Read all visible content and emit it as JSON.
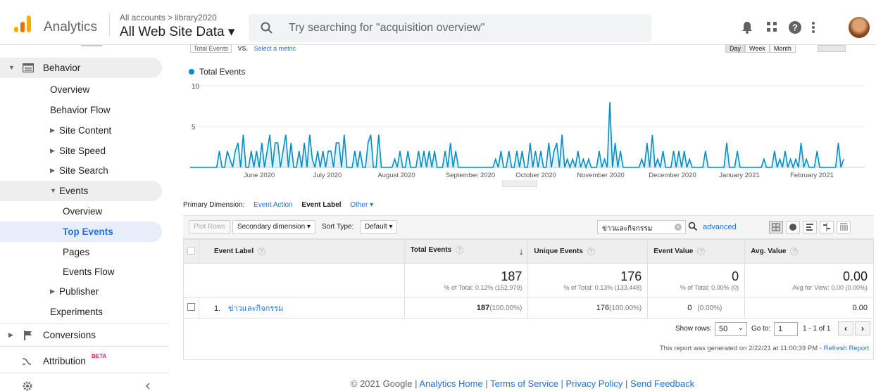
{
  "header": {
    "app_name": "Analytics",
    "breadcrumb": "All accounts > library2020",
    "property": "All Web Site Data ▾",
    "search_placeholder": "Try searching for \"acquisition overview\""
  },
  "sidebar": {
    "behavior": "Behavior",
    "overview": "Overview",
    "behavior_flow": "Behavior Flow",
    "site_content": "Site Content",
    "site_speed": "Site Speed",
    "site_search": "Site Search",
    "events": "Events",
    "events_overview": "Overview",
    "top_events": "Top Events",
    "pages": "Pages",
    "events_flow": "Events Flow",
    "publisher": "Publisher",
    "experiments": "Experiments",
    "conversions": "Conversions",
    "attribution": "Attribution",
    "beta": "BETA"
  },
  "chart_top": {
    "metric_select": "Total Events",
    "vs": "VS.",
    "select_metric": "Select a metric",
    "day": "Day",
    "week": "Week",
    "month": "Month"
  },
  "chart_data": {
    "type": "line",
    "title": "",
    "legend": "Total Events",
    "y_ticks": [
      "10",
      "5"
    ],
    "ylim": [
      0,
      10
    ],
    "x_tick_labels": [
      "June 2020",
      "July 2020",
      "August 2020",
      "September 2020",
      "October 2020",
      "November 2020",
      "December 2020",
      "January 2021",
      "February 2021"
    ],
    "series": [
      {
        "name": "Total Events",
        "values": [
          0,
          0,
          0,
          0,
          0,
          0,
          0,
          0,
          0,
          0,
          0,
          2,
          0,
          0,
          2,
          1,
          0,
          2,
          3,
          0,
          4,
          0,
          0,
          2,
          0,
          2,
          0,
          3,
          0,
          2,
          4,
          0,
          3,
          3,
          0,
          2,
          4,
          0,
          3,
          0,
          0,
          2,
          0,
          3,
          0,
          4,
          1,
          0,
          2,
          0,
          2,
          0,
          2,
          2,
          0,
          3,
          3,
          0,
          4,
          0,
          0,
          0,
          2,
          0,
          2,
          0,
          0,
          3,
          4,
          0,
          0,
          4,
          0,
          0,
          0,
          0,
          0,
          1,
          0,
          2,
          0,
          0,
          2,
          0,
          0,
          0,
          2,
          0,
          2,
          0,
          2,
          0,
          2,
          0,
          0,
          0,
          2,
          0,
          3,
          0,
          2,
          0,
          0,
          0,
          0,
          0,
          0,
          0,
          0,
          0,
          0,
          0,
          0,
          0,
          0,
          1,
          0,
          2,
          0,
          0,
          2,
          0,
          0,
          2,
          0,
          2,
          0,
          0,
          3,
          0,
          2,
          0,
          2,
          0,
          0,
          3,
          0,
          2,
          3,
          0,
          4,
          0,
          1,
          0,
          1,
          0,
          2,
          0,
          1,
          0,
          1,
          0,
          0,
          0,
          2,
          0,
          1,
          0,
          8,
          0,
          3,
          0,
          2,
          0,
          0,
          0,
          0,
          0,
          0,
          0,
          1,
          0,
          3,
          0,
          4,
          0,
          1,
          0,
          2,
          0,
          0,
          0,
          2,
          0,
          2,
          0,
          2,
          0,
          1,
          0,
          0,
          0,
          0,
          0,
          2,
          0,
          0,
          0,
          0,
          0,
          0,
          0,
          3,
          0,
          0,
          0,
          2,
          0,
          0,
          0,
          0,
          0,
          0,
          0,
          0,
          0,
          1,
          0,
          0,
          0,
          2,
          0,
          1,
          0,
          2,
          0,
          1,
          0,
          1,
          0,
          3,
          0,
          1,
          0,
          0,
          0,
          2,
          0,
          0,
          0,
          0,
          0,
          0,
          0,
          3,
          0,
          1
        ]
      }
    ]
  },
  "report": {
    "primary_dimension_label": "Primary Dimension:",
    "dim_event_action": "Event Action",
    "dim_event_label": "Event Label",
    "dim_other": "Other ▾",
    "plot_rows": "Plot Rows",
    "secondary_dimension": "Secondary dimension ▾",
    "sort_type_label": "Sort Type:",
    "sort_type_value": "Default ▾",
    "filter_value": "ข่าวและกิจกรรม",
    "advanced": "advanced",
    "columns": [
      "Event Label",
      "Total Events",
      "Unique Events",
      "Event Value",
      "Avg. Value"
    ],
    "totals": {
      "total_events": "187",
      "total_events_pct": "% of Total: 0.12% (152,979)",
      "unique_events": "176",
      "unique_events_pct": "% of Total: 0.13% (133,448)",
      "event_value": "0",
      "event_value_pct": "% of Total: 0.00% (0)",
      "avg_value": "0.00",
      "avg_value_pct": "Avg for View: 0.00 (0.00%)"
    },
    "rows": [
      {
        "index": "1.",
        "label": "ข่าวและกิจกรรม",
        "total_events": "187",
        "total_events_pct": "(100.00%)",
        "unique_events": "176",
        "unique_events_pct": "(100.00%)",
        "event_value": "0",
        "event_value_pct": "(0.00%)",
        "avg_value": "0.00"
      }
    ],
    "show_rows_label": "Show rows:",
    "show_rows_value": "50",
    "goto_label": "Go to:",
    "goto_value": "1",
    "range": "1 - 1 of 1",
    "generated_prefix": "This report was generated on 2/22/21 at 11:00:39 PM - ",
    "refresh": "Refresh Report"
  },
  "footer": {
    "copyright": "© 2021 Google | ",
    "analytics_home": "Analytics Home",
    "terms": "Terms of Service",
    "privacy": "Privacy Policy",
    "feedback": "Send Feedback",
    "sep": " | "
  }
}
